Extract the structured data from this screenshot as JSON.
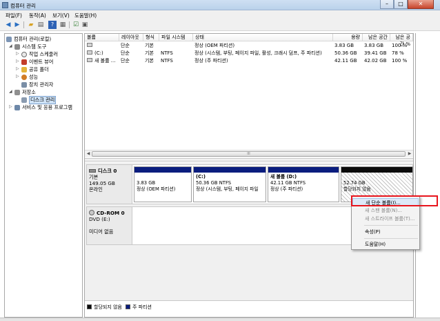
{
  "window": {
    "title": "컴퓨터 관리"
  },
  "menu": [
    "파일(F)",
    "동작(A)",
    "보기(V)",
    "도움말(H)"
  ],
  "toolbar": {
    "buttons": [
      "back-icon",
      "forward-icon",
      "folder-icon",
      "properties-icon",
      "help-icon",
      "view-icon",
      "check-icon",
      "properties2-icon"
    ]
  },
  "tree": {
    "items": [
      {
        "label": "컴퓨터 관리(로컬)",
        "icon": "computer-icon"
      },
      {
        "label": "시스템 도구",
        "icon": "tools-icon"
      },
      {
        "label": "작업 스케줄러",
        "icon": "clock-icon"
      },
      {
        "label": "이벤트 뷰어",
        "icon": "event-icon"
      },
      {
        "label": "공유 폴더",
        "icon": "folder-icon"
      },
      {
        "label": "성능",
        "icon": "performance-icon"
      },
      {
        "label": "장치 관리자",
        "icon": "device-icon"
      },
      {
        "label": "저장소",
        "icon": "storage-icon"
      },
      {
        "label": "디스크 관리",
        "icon": "disk-icon"
      },
      {
        "label": "서비스 및 응용 프로그램",
        "icon": "services-icon"
      }
    ]
  },
  "volumes": {
    "headers": [
      "볼륨",
      "레이아웃",
      "형식",
      "파일 시스템",
      "상태",
      "용량",
      "남은 공간",
      "남은 공간 %"
    ],
    "rows": [
      {
        "volume": "",
        "layout": "단순",
        "type": "기본",
        "fs": "",
        "status": "정상 (OEM 파티션)",
        "capacity": "3.83 GB",
        "free": "3.83 GB",
        "pct": "100 %"
      },
      {
        "volume": "(C:)",
        "layout": "단순",
        "type": "기본",
        "fs": "NTFS",
        "status": "정상 (시스템, 부팅, 페이지 파일, 활성, 크래시 덤프, 주 파티션)",
        "capacity": "50.36 GB",
        "free": "39.41 GB",
        "pct": "78 %"
      },
      {
        "volume": "새 볼륨 ...",
        "layout": "단순",
        "type": "기본",
        "fs": "NTFS",
        "status": "정상 (주 파티션)",
        "capacity": "42.11 GB",
        "free": "42.02 GB",
        "pct": "100 %"
      }
    ]
  },
  "scrollbar_glyph": "III",
  "disks": {
    "disk0": {
      "title": "디스크 0",
      "type": "기본",
      "size": "149.05 GB",
      "state": "온라인",
      "partitions": [
        {
          "name": "",
          "size": "3.83 GB",
          "status": "정상 (OEM 파티션)"
        },
        {
          "name": "(C:)",
          "size": "50.36 GB NTFS",
          "status": "정상 (시스템, 부팅, 페이지 파일"
        },
        {
          "name": "새 볼륨 (D:)",
          "size": "42.11 GB NTFS",
          "status": "정상 (주 파티션)"
        },
        {
          "name": "",
          "size": "52.74 GB",
          "status": "할당되지 않음"
        }
      ]
    },
    "cdrom0": {
      "title": "CD-ROM 0",
      "type": "DVD (E:)",
      "state": "미디어 없음"
    }
  },
  "legend": [
    "할당되지 않음",
    "주 파티션"
  ],
  "context_menu": {
    "items": [
      {
        "label": "새 단순 볼륨(I)...",
        "enabled": true
      },
      {
        "label": "새 스팬 볼륨(N)...",
        "enabled": false
      },
      {
        "label": "새 스트라이프 볼륨(T)...",
        "enabled": false
      },
      {
        "label": "속성(P)",
        "enabled": true
      },
      {
        "label": "도움말(H)",
        "enabled": true
      }
    ]
  },
  "colors": {
    "primary_partition": "#0a1d7e",
    "unallocated": "#0b0b0b",
    "highlight": "#e8141c"
  }
}
